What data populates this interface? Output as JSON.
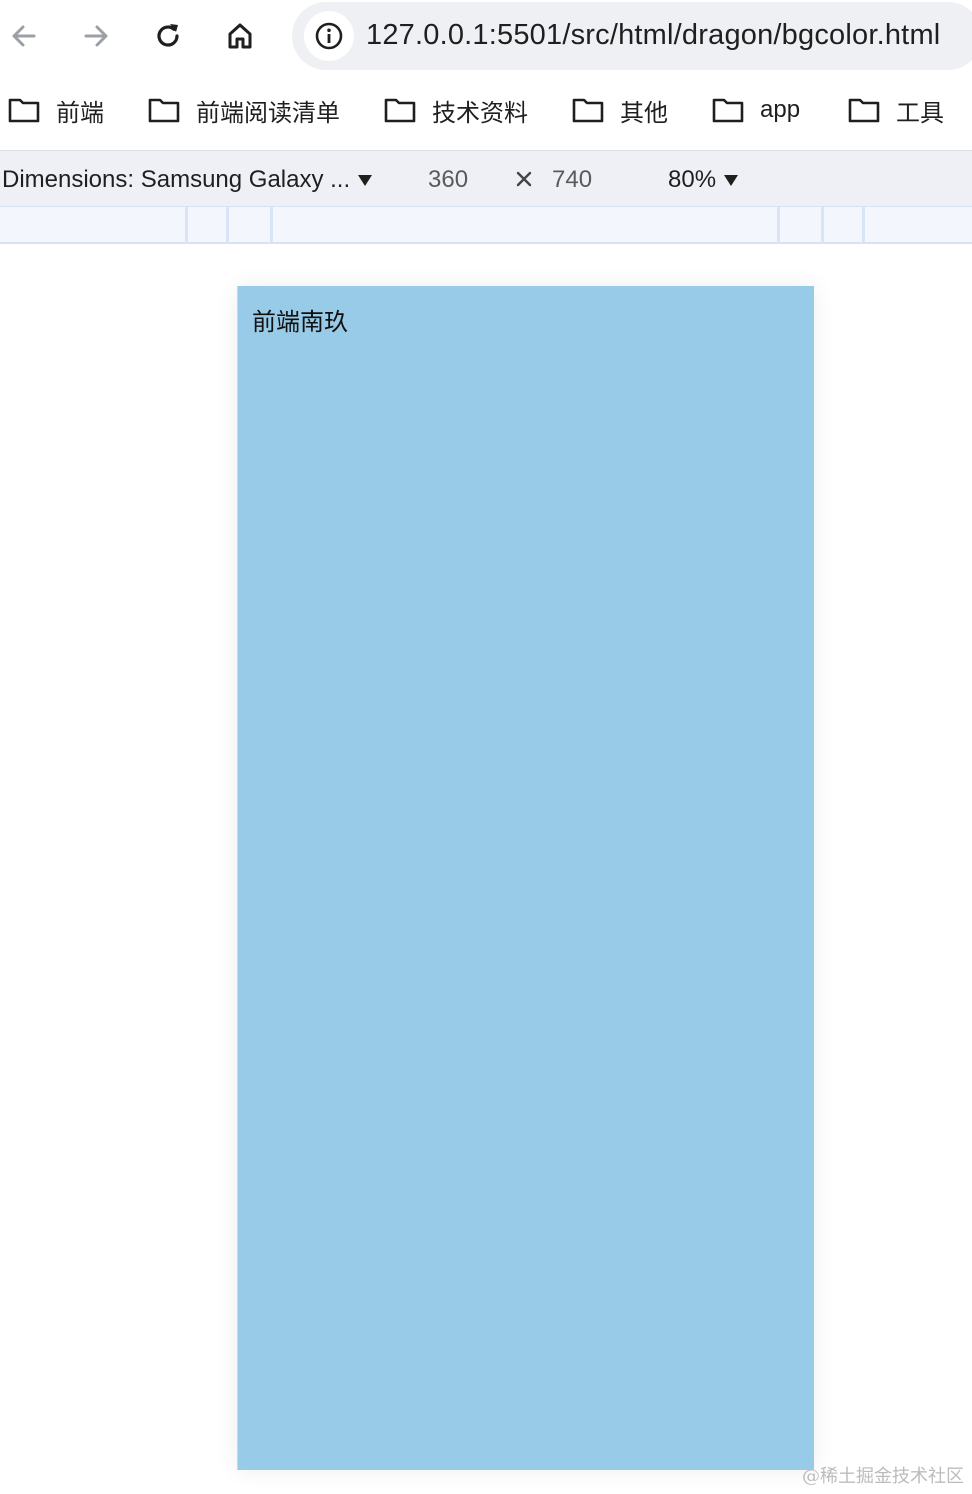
{
  "toolbar": {
    "back_icon": "arrow-left-icon",
    "forward_icon": "arrow-right-icon",
    "reload_icon": "reload-icon",
    "home_icon": "home-icon",
    "site_info_icon": "info-icon",
    "url": "127.0.0.1:5501/src/html/dragon/bgcolor.html"
  },
  "bookmarks": {
    "items": [
      {
        "label": "前端",
        "icon": "folder-icon"
      },
      {
        "label": "前端阅读清单",
        "icon": "folder-icon"
      },
      {
        "label": "技术资料",
        "icon": "folder-icon"
      },
      {
        "label": "其他",
        "icon": "folder-icon"
      },
      {
        "label": "app",
        "icon": "folder-icon"
      },
      {
        "label": "工具",
        "icon": "folder-icon"
      }
    ]
  },
  "device_toolbar": {
    "dimensions_label": "Dimensions: Samsung Galaxy ...",
    "width_value": "360",
    "height_value": "740",
    "zoom_label": "80%"
  },
  "page": {
    "text": "前端南玖",
    "background_color": "#97cbe7"
  },
  "watermark": "@稀土掘金技术社区"
}
